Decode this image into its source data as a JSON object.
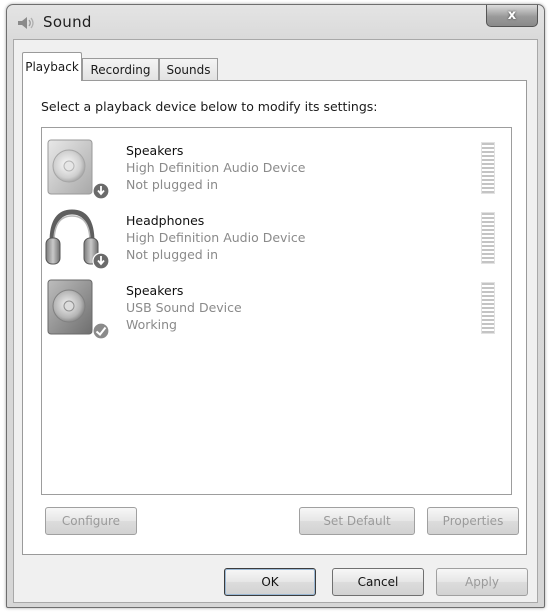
{
  "window": {
    "title": "Sound",
    "close_label": "x"
  },
  "tabs": [
    {
      "label": "Playback",
      "active": true
    },
    {
      "label": "Recording",
      "active": false
    },
    {
      "label": "Sounds",
      "active": false
    }
  ],
  "playback": {
    "instruction": "Select a playback device below to modify its settings:",
    "devices": [
      {
        "name": "Speakers",
        "description": "High Definition Audio Device",
        "status": "Not plugged in",
        "icon": "speaker-icon",
        "badge": "down-arrow-badge-icon"
      },
      {
        "name": "Headphones",
        "description": "High Definition Audio Device",
        "status": "Not plugged in",
        "icon": "headphones-icon",
        "badge": "down-arrow-badge-icon"
      },
      {
        "name": "Speakers",
        "description": "USB Sound Device",
        "status": "Working",
        "icon": "speaker-icon",
        "badge": "checkmark-badge-icon"
      }
    ]
  },
  "panel_buttons": {
    "configure": "Configure",
    "set_default": "Set Default",
    "properties": "Properties"
  },
  "dialog_buttons": {
    "ok": "OK",
    "cancel": "Cancel",
    "apply": "Apply"
  }
}
